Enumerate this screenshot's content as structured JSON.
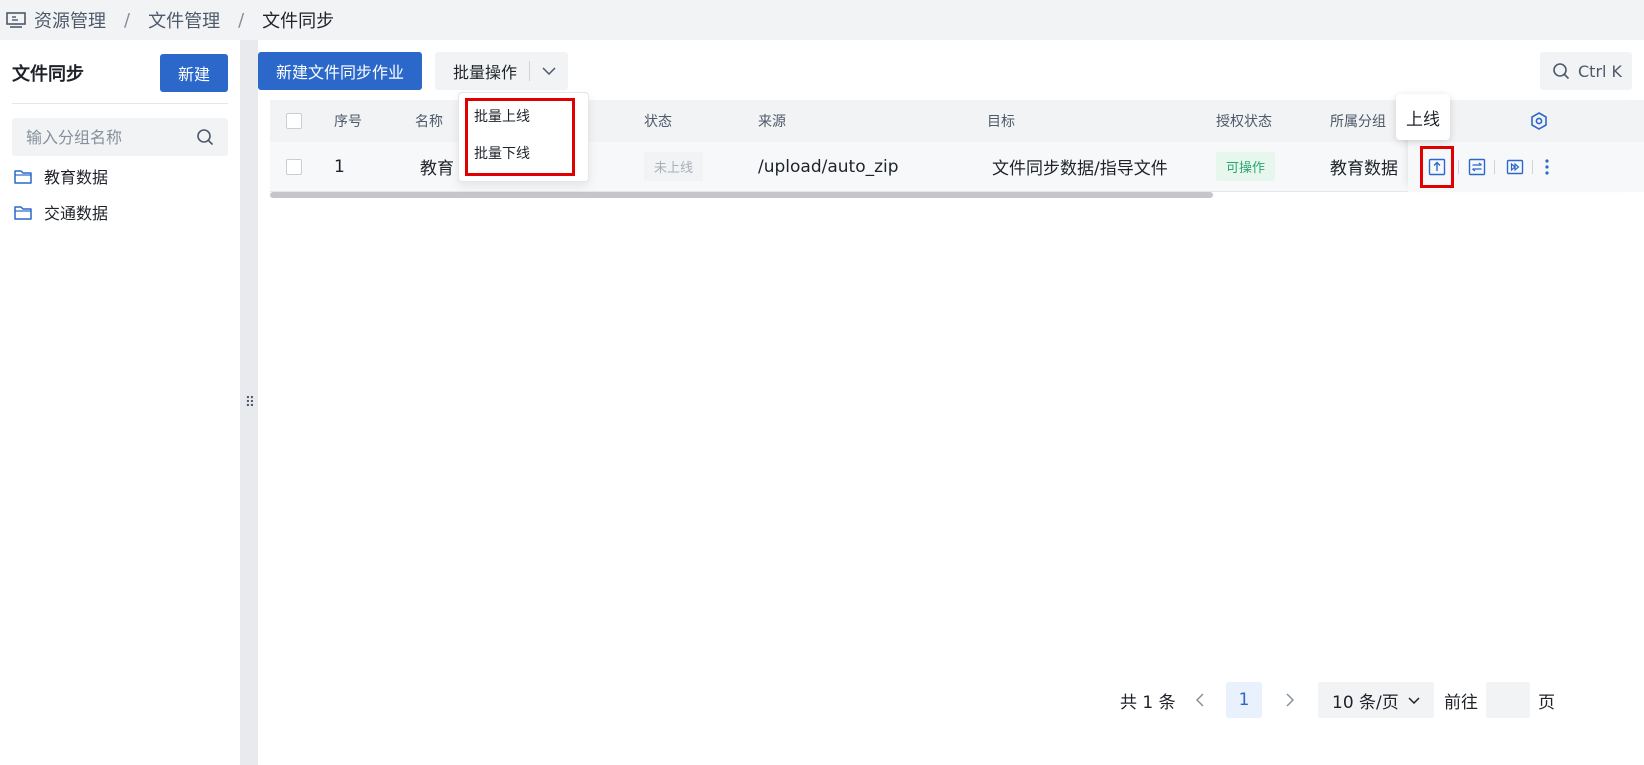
{
  "breadcrumb": {
    "items": [
      "资源管理",
      "文件管理",
      "文件同步"
    ],
    "separator": "/"
  },
  "sidebar": {
    "title": "文件同步",
    "new_button": "新建",
    "search_placeholder": "输入分组名称",
    "groups": [
      {
        "label": "教育数据",
        "icon": "folder-icon"
      },
      {
        "label": "交通数据",
        "icon": "folder-icon"
      }
    ]
  },
  "toolbar": {
    "new_job_button": "新建文件同步作业",
    "batch_button": "批量操作",
    "batch_menu": [
      "批量上线",
      "批量下线"
    ],
    "search_shortcut": "Ctrl K"
  },
  "table": {
    "columns": [
      "序号",
      "名称",
      "状态",
      "来源",
      "目标",
      "授权状态",
      "所属分组"
    ],
    "rows": [
      {
        "index": "1",
        "name": "教育",
        "status": "未上线",
        "source": "/upload/auto_zip",
        "target": "文件同步数据/指导文件",
        "auth_status": "可操作",
        "group": "教育数据"
      }
    ],
    "tooltip": "上线",
    "row_actions": [
      "publish-icon",
      "swap-icon",
      "run-icon",
      "more-icon"
    ]
  },
  "pagination": {
    "total": "共 1 条",
    "current_page": "1",
    "page_size": "10 条/页",
    "goto_label": "前往",
    "page_suffix": "页"
  },
  "colors": {
    "primary": "#2c68c9",
    "highlight": "#e00000",
    "success": "#2ba471"
  }
}
